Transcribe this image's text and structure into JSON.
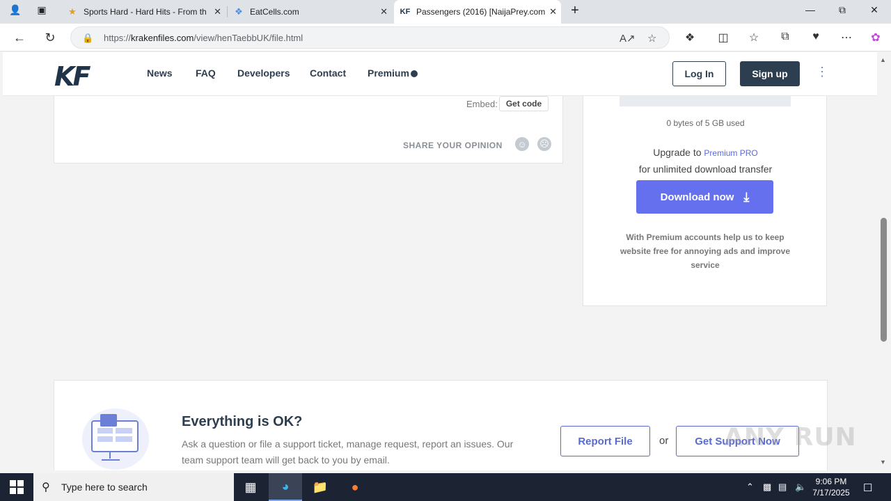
{
  "browser": {
    "tabs": [
      {
        "title": "Sports Hard - Hard Hits - From th",
        "icon": "star-favicon"
      },
      {
        "title": "EatCells.com",
        "icon": "puzzle-favicon"
      },
      {
        "title": "Passengers (2016) [NaijaPrey.com",
        "icon": "kf-favicon"
      }
    ],
    "new_tab_label": "+",
    "url_prefix": "https://",
    "url_domain": "krakenfiles.com",
    "url_path": "/view/henTaebbUK/file.html"
  },
  "site": {
    "logo": "KF",
    "nav": [
      "News",
      "FAQ",
      "Developers",
      "Contact",
      "Premium"
    ],
    "login": "Log In",
    "signup": "Sign up"
  },
  "file_card": {
    "embed_label": "Embed:",
    "get_code": "Get code",
    "share_label": "SHARE YOUR OPINION"
  },
  "download_card": {
    "usage": "0 bytes of 5 GB used",
    "usage_fraction": 0,
    "upgrade_prefix": "Upgrade to ",
    "upgrade_link": "Premium PRO",
    "upgrade_suffix": "for unlimited download transfer",
    "download_button": "Download now",
    "premium_note": "With Premium accounts help us to keep website free for annoying ads and improve service"
  },
  "support": {
    "title": "Everything is OK?",
    "description": "Ask a question or file a support ticket, manage request, report an issues. Our team support team will get back to you by email.",
    "report_button": "Report File",
    "or": "or",
    "support_button": "Get Support Now"
  },
  "watermark": "ANY RUN",
  "taskbar": {
    "search_placeholder": "Type here to search",
    "time": "9:06 PM",
    "date": "7/17/2025"
  }
}
